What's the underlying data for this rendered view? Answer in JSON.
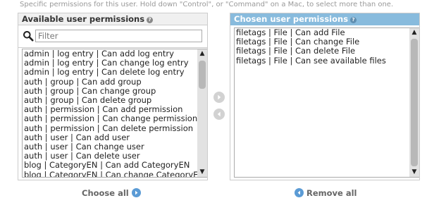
{
  "help_text": "Specific permissions for this user. Hold down \"Control\", or \"Command\" on a Mac, to select more than one.",
  "available": {
    "title": "Available user permissions",
    "help_glyph": "?",
    "filter_placeholder": "Filter",
    "options": [
      "admin | log entry | Can add log entry",
      "admin | log entry | Can change log entry",
      "admin | log entry | Can delete log entry",
      "auth | group | Can add group",
      "auth | group | Can change group",
      "auth | group | Can delete group",
      "auth | permission | Can add permission",
      "auth | permission | Can change permission",
      "auth | permission | Can delete permission",
      "auth | user | Can add user",
      "auth | user | Can change user",
      "auth | user | Can delete user",
      "blog | CategoryEN | Can add CategoryEN",
      "blog | CategoryEN | Can change CategoryEN"
    ]
  },
  "chosen": {
    "title": "Chosen user permissions",
    "help_glyph": "?",
    "options": [
      "filetags | File | Can add File",
      "filetags | File | Can change File",
      "filetags | File | Can delete File",
      "filetags | File | Can see available files"
    ]
  },
  "actions": {
    "choose_all": "Choose all",
    "remove_all": "Remove all"
  },
  "icons": {
    "search": "search-icon",
    "add": "arrow-right-circle-icon",
    "remove": "arrow-left-circle-icon",
    "scroll_up": "▲",
    "scroll_down": "▼"
  },
  "colors": {
    "chosen_header": "#88bbdd",
    "footer_icon": "#5b9bd5"
  }
}
